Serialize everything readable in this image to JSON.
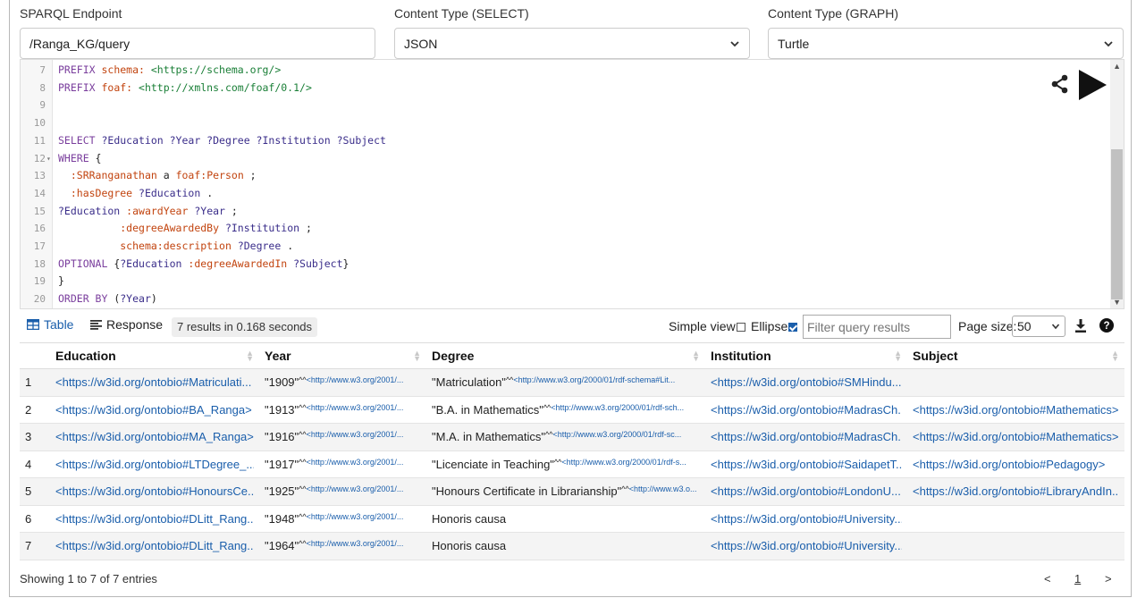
{
  "header": {
    "endpoint_label": "SPARQL Endpoint",
    "endpoint_value": "/Ranga_KG/query",
    "select_label": "Content Type (SELECT)",
    "select_value": "JSON",
    "graph_label": "Content Type (GRAPH)",
    "graph_value": "Turtle"
  },
  "editor": {
    "lines": [
      {
        "n": "7",
        "fold": "",
        "tokens": [
          [
            "kw",
            "PREFIX "
          ],
          [
            "pf",
            "schema: "
          ],
          [
            "iri",
            "<https://schema.org/>"
          ]
        ]
      },
      {
        "n": "8",
        "fold": "",
        "tokens": [
          [
            "kw",
            "PREFIX "
          ],
          [
            "pf",
            "foaf: "
          ],
          [
            "iri",
            "<http://xmlns.com/foaf/0.1/>"
          ]
        ]
      },
      {
        "n": "9",
        "fold": "",
        "tokens": []
      },
      {
        "n": "10",
        "fold": "",
        "tokens": []
      },
      {
        "n": "11",
        "fold": "",
        "tokens": [
          [
            "kw",
            "SELECT "
          ],
          [
            "var",
            "?Education ?Year ?Degree ?Institution ?Subject"
          ]
        ]
      },
      {
        "n": "12",
        "fold": "▾",
        "tokens": [
          [
            "kw",
            "WHERE "
          ],
          [
            "pn",
            "{"
          ]
        ]
      },
      {
        "n": "13",
        "fold": "",
        "tokens": [
          [
            "pn",
            "  "
          ],
          [
            "pf",
            ":SRRanganathan "
          ],
          [
            "pn",
            "a "
          ],
          [
            "pf",
            "foaf:Person "
          ],
          [
            "pn",
            ";"
          ]
        ]
      },
      {
        "n": "14",
        "fold": "",
        "tokens": [
          [
            "pn",
            "  "
          ],
          [
            "pf",
            ":hasDegree "
          ],
          [
            "var",
            "?Education "
          ],
          [
            "pn",
            "."
          ]
        ]
      },
      {
        "n": "15",
        "fold": "",
        "tokens": [
          [
            "var",
            "?Education "
          ],
          [
            "pf",
            ":awardYear "
          ],
          [
            "var",
            "?Year "
          ],
          [
            "pn",
            ";"
          ]
        ]
      },
      {
        "n": "16",
        "fold": "",
        "tokens": [
          [
            "pn",
            "          "
          ],
          [
            "pf",
            ":degreeAwardedBy "
          ],
          [
            "var",
            "?Institution "
          ],
          [
            "pn",
            ";"
          ]
        ]
      },
      {
        "n": "17",
        "fold": "",
        "tokens": [
          [
            "pn",
            "          "
          ],
          [
            "pf",
            "schema:description "
          ],
          [
            "var",
            "?Degree "
          ],
          [
            "pn",
            "."
          ]
        ]
      },
      {
        "n": "18",
        "fold": "",
        "tokens": [
          [
            "kw",
            "OPTIONAL "
          ],
          [
            "pn",
            "{"
          ],
          [
            "var",
            "?Education "
          ],
          [
            "pf",
            ":degreeAwardedIn "
          ],
          [
            "var",
            "?Subject"
          ],
          [
            "pn",
            "}"
          ]
        ]
      },
      {
        "n": "19",
        "fold": "",
        "tokens": [
          [
            "pn",
            "}"
          ]
        ]
      },
      {
        "n": "20",
        "fold": "",
        "tokens": [
          [
            "kw",
            "ORDER BY "
          ],
          [
            "pn",
            "("
          ],
          [
            "var",
            "?Year"
          ],
          [
            "pn",
            ")"
          ]
        ]
      }
    ]
  },
  "results_bar": {
    "table_tab": "Table",
    "response_tab": "Response",
    "summary": "7 results in 0.168 seconds",
    "simple_view": "Simple view",
    "ellipse": "Ellipse",
    "filter_placeholder": "Filter query results",
    "page_size_label": "Page size:",
    "page_size_value": "50"
  },
  "table": {
    "columns": [
      "Education",
      "Year",
      "Degree",
      "Institution",
      "Subject"
    ],
    "rows": [
      {
        "num": "1",
        "education": "<https://w3id.org/ontobio#Matriculati...",
        "year": "\"1909\"",
        "year_type": "<http://www.w3.org/2001/...",
        "degree": "\"Matriculation\"",
        "degree_type": "<http://www.w3.org/2000/01/rdf-schema#Lit...",
        "institution": "<https://w3id.org/ontobio#SMHindu...",
        "subject": ""
      },
      {
        "num": "2",
        "education": "<https://w3id.org/ontobio#BA_Ranga>",
        "year": "\"1913\"",
        "year_type": "<http://www.w3.org/2001/...",
        "degree": "\"B.A. in Mathematics\"",
        "degree_type": "<http://www.w3.org/2000/01/rdf-sch...",
        "institution": "<https://w3id.org/ontobio#MadrasCh...",
        "subject": "<https://w3id.org/ontobio#Mathematics>"
      },
      {
        "num": "3",
        "education": "<https://w3id.org/ontobio#MA_Ranga>",
        "year": "\"1916\"",
        "year_type": "<http://www.w3.org/2001/...",
        "degree": "\"M.A. in Mathematics\"",
        "degree_type": "<http://www.w3.org/2000/01/rdf-sc...",
        "institution": "<https://w3id.org/ontobio#MadrasCh...",
        "subject": "<https://w3id.org/ontobio#Mathematics>"
      },
      {
        "num": "4",
        "education": "<https://w3id.org/ontobio#LTDegree_...",
        "year": "\"1917\"",
        "year_type": "<http://www.w3.org/2001/...",
        "degree": "\"Licenciate in Teaching\"",
        "degree_type": "<http://www.w3.org/2000/01/rdf-s...",
        "institution": "<https://w3id.org/ontobio#SaidapetT...",
        "subject": "<https://w3id.org/ontobio#Pedagogy>"
      },
      {
        "num": "5",
        "education": "<https://w3id.org/ontobio#HonoursCe...",
        "year": "\"1925\"",
        "year_type": "<http://www.w3.org/2001/...",
        "degree": "\"Honours Certificate in Librarianship\"",
        "degree_type": "<http://www.w3.o...",
        "institution": "<https://w3id.org/ontobio#LondonU...",
        "subject": "<https://w3id.org/ontobio#LibraryAndIn..."
      },
      {
        "num": "6",
        "education": "<https://w3id.org/ontobio#DLitt_Rang...",
        "year": "\"1948\"",
        "year_type": "<http://www.w3.org/2001/...",
        "degree": "Honoris causa",
        "degree_type": "",
        "institution": "<https://w3id.org/ontobio#University...",
        "subject": ""
      },
      {
        "num": "7",
        "education": "<https://w3id.org/ontobio#DLitt_Rang...",
        "year": "\"1964\"",
        "year_type": "<http://www.w3.org/2001/...",
        "degree": "Honoris causa",
        "degree_type": "",
        "institution": "<https://w3id.org/ontobio#University...",
        "subject": ""
      }
    ]
  },
  "footer": {
    "entries_text": "Showing 1 to 7 of 7 entries",
    "prev": "<",
    "page": "1",
    "next": ">"
  },
  "colors": {
    "accent": "#1a5eab",
    "keyword": "#7a3e9d",
    "prefix": "#c2440f",
    "iri": "#1a7f37"
  }
}
